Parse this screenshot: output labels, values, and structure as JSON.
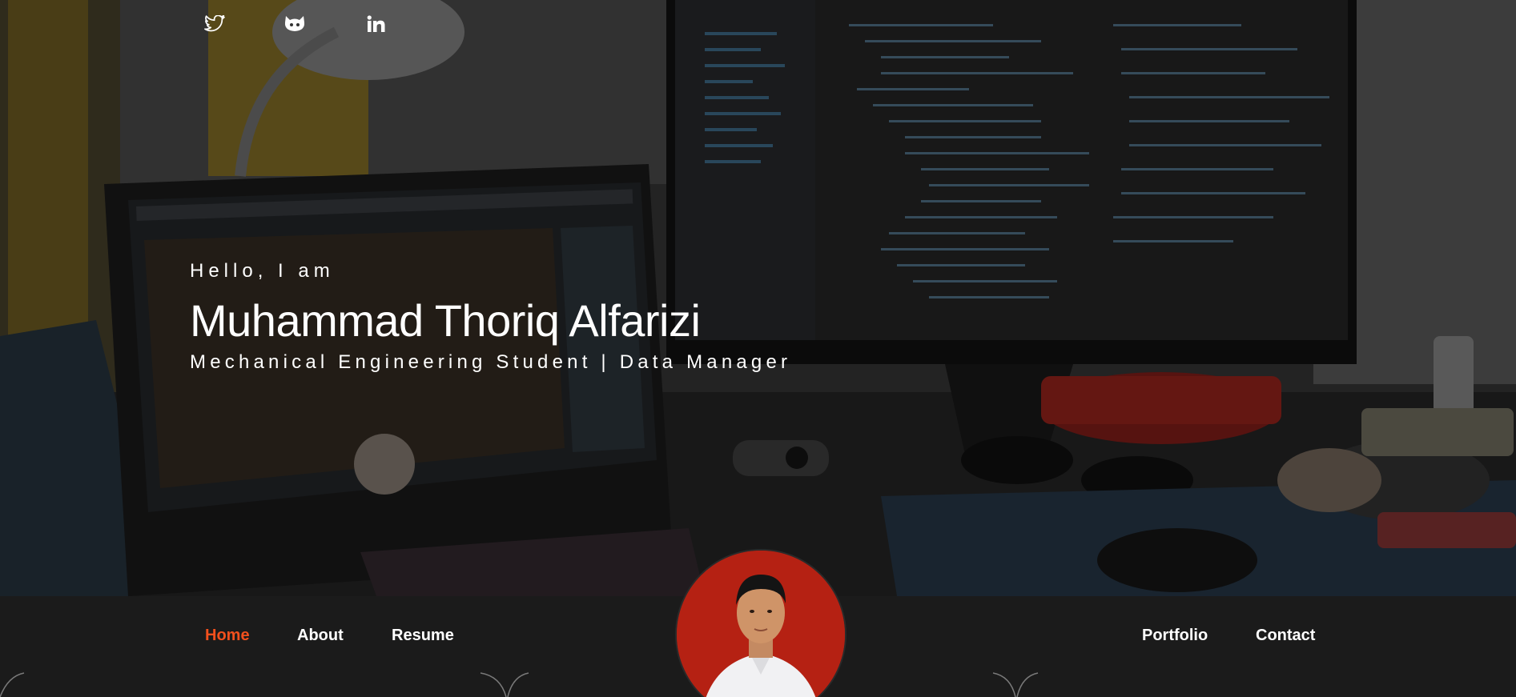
{
  "hero": {
    "greeting": "Hello, I am",
    "name": "Muhammad Thoriq Alfarizi",
    "tagline": "Mechanical Engineering Student | Data Manager"
  },
  "social": [
    {
      "icon": "twitter-icon"
    },
    {
      "icon": "github-icon"
    },
    {
      "icon": "linkedin-icon"
    }
  ],
  "nav": {
    "left": [
      "Home",
      "About",
      "Resume"
    ],
    "right": [
      "Portfolio",
      "Contact"
    ],
    "active": "Home"
  },
  "colors": {
    "accent": "#f2501d",
    "nav_background": "#1b1b1b",
    "avatar_background": "#b52113"
  }
}
